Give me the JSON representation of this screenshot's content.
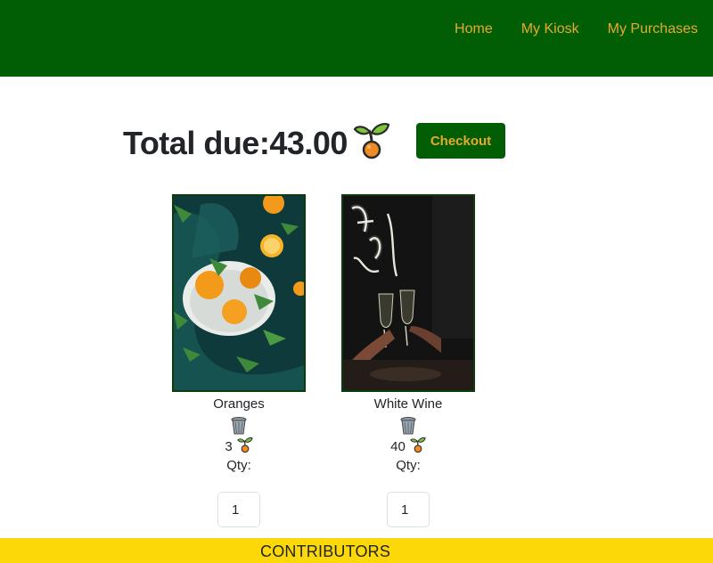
{
  "nav": {
    "links": [
      "Home",
      "My Kiosk",
      "My Purchases"
    ]
  },
  "cart": {
    "total_label": "Total due:",
    "total_value": "43.00",
    "currency_icon": "sprout-icon",
    "checkout_label": "Checkout"
  },
  "products": [
    {
      "name": "Oranges",
      "price": "3",
      "qty_label": "Qty:",
      "qty_value": "1",
      "image_icon": "oranges-photo"
    },
    {
      "name": "White Wine",
      "price": "40",
      "qty_label": "Qty:",
      "qty_value": "1",
      "image_icon": "wine-glasses-photo",
      "neon_sign_text": "Fun & Talk"
    }
  ],
  "footer": {
    "title": "CONTRIBUTORS"
  },
  "colors": {
    "navbar": "#025e04",
    "nav_text": "#e8a92a",
    "footer": "#fcd808",
    "checkout_bg": "#025e04",
    "checkout_text": "#e8a92a"
  }
}
